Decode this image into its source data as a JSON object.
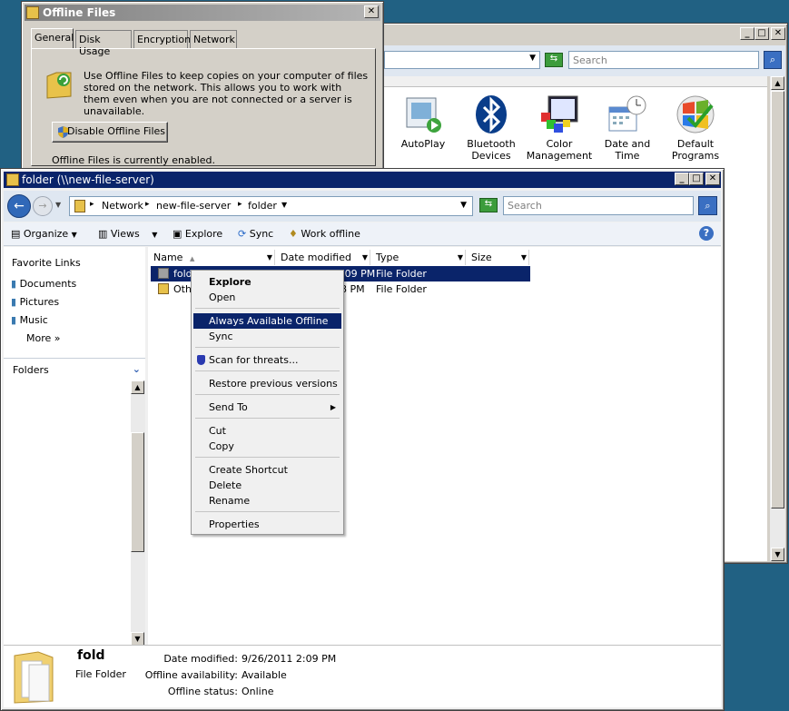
{
  "control_panel": {
    "search_placeholder": "Search",
    "items": [
      {
        "label": "AutoPlay",
        "icon": "autoplay-icon"
      },
      {
        "label": "Bluetooth Devices",
        "icon": "bluetooth-icon"
      },
      {
        "label": "Color Management",
        "icon": "color-management-icon"
      },
      {
        "label": "Date and Time",
        "icon": "calendar-clock-icon"
      },
      {
        "label": "Default Programs",
        "icon": "windows-logo-icon"
      }
    ]
  },
  "offline_dialog": {
    "title": "Offline Files",
    "tabs": [
      "General",
      "Disk Usage",
      "Encryption",
      "Network"
    ],
    "description": "Use Offline Files to keep copies on your computer of files stored on the network.  This allows you to work with them even when you are not connected or a server is unavailable.",
    "disable_button": "Disable Offline Files",
    "status": "Offline Files is currently enabled."
  },
  "explorer": {
    "title": "folder (\\\\new-file-server)",
    "breadcrumb": [
      "Network",
      "new-file-server",
      "folder"
    ],
    "search_placeholder": "Search",
    "toolbar": {
      "organize": "Organize",
      "views": "Views",
      "explore": "Explore",
      "sync": "Sync",
      "work_offline": "Work offline"
    },
    "favorite_links_title": "Favorite Links",
    "favorite_links": [
      "Documents",
      "Pictures",
      "Music"
    ],
    "more": "More",
    "folders_label": "Folders",
    "columns": [
      "Name",
      "Date modified",
      "Type",
      "Size"
    ],
    "rows": [
      {
        "name": "fold",
        "date": "9/26/2011 2:09 PM",
        "type": "File Folder"
      },
      {
        "name": "Oth",
        "date": "8 PM",
        "type": "File Folder"
      }
    ],
    "details": {
      "name": "fold",
      "kind": "File Folder",
      "date_label": "Date modified:",
      "date_value": "9/26/2011 2:09 PM",
      "avail_label": "Offline availability:",
      "avail_value": "Available",
      "status_label": "Offline status:",
      "status_value": "Online"
    }
  },
  "context_menu": {
    "items": [
      "Explore",
      "Open",
      "Always Available Offline",
      "Sync",
      "Scan for threats...",
      "Restore previous versions",
      "Send To",
      "Cut",
      "Copy",
      "Create Shortcut",
      "Delete",
      "Rename",
      "Properties"
    ]
  },
  "colors": {
    "desktop": "#216183",
    "selection": "#0a246a",
    "titlebar_active": "#0a246a"
  }
}
